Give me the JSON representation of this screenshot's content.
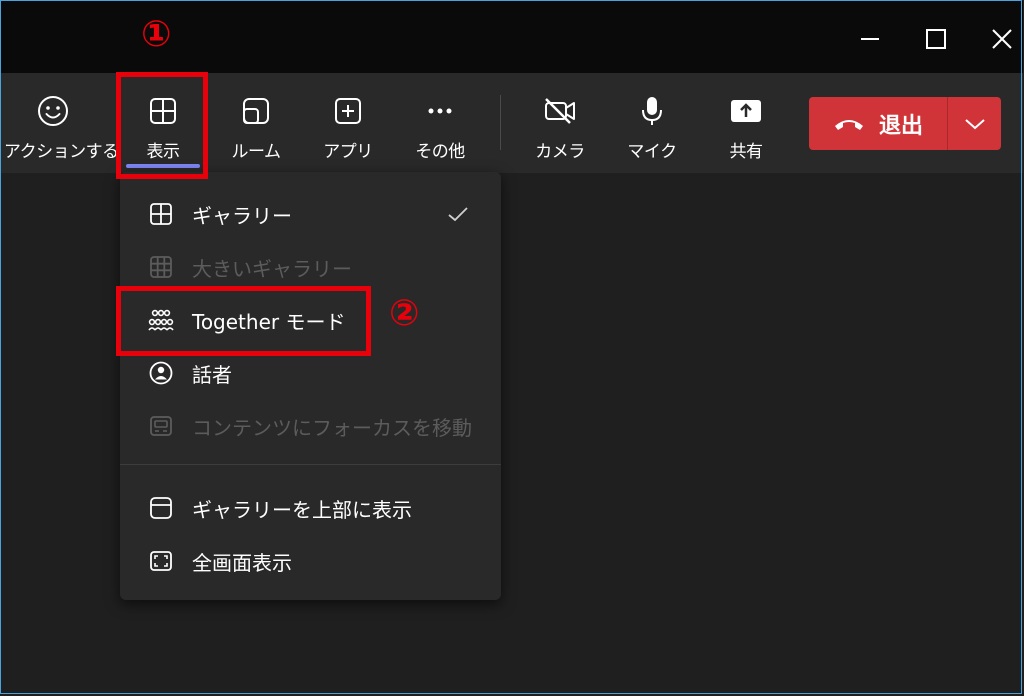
{
  "window": {
    "controls": [
      "minimize-icon",
      "maximize-icon",
      "close-icon"
    ]
  },
  "toolbar": {
    "reactions_label": "リアクションする",
    "view_label": "表示",
    "rooms_label": "ルーム",
    "apps_label": "アプリ",
    "more_label": "その他",
    "camera_label": "カメラ",
    "mic_label": "マイク",
    "share_label": "共有",
    "leave_label": "退出"
  },
  "menu": {
    "items": [
      {
        "label": "ギャラリー",
        "icon": "grid-icon",
        "checked": true,
        "enabled": true
      },
      {
        "label": "大きいギャラリー",
        "icon": "large-grid-icon",
        "enabled": false
      },
      {
        "label": "Together モード",
        "icon": "together-mode-icon",
        "enabled": true
      },
      {
        "label": "話者",
        "icon": "speaker-icon",
        "enabled": true
      },
      {
        "label": "コンテンツにフォーカスを移動",
        "icon": "content-focus-icon",
        "enabled": false
      },
      {
        "label": "ギャラリーを上部に表示",
        "icon": "gallery-top-icon",
        "enabled": true
      },
      {
        "label": "全画面表示",
        "icon": "fullscreen-icon",
        "enabled": true
      }
    ]
  },
  "annotations": {
    "step1": "①",
    "step2": "②"
  },
  "colors": {
    "accent": "#7f85f5",
    "leave": "#d13438",
    "annotation": "#e8000b"
  }
}
